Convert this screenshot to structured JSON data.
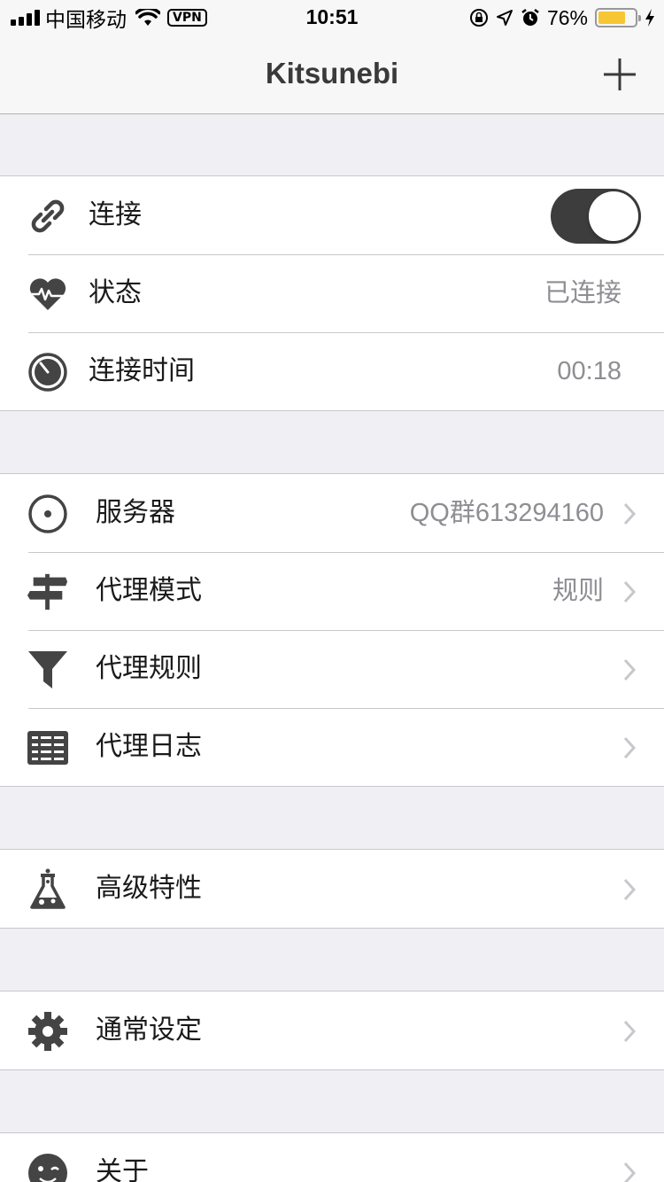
{
  "status_bar": {
    "carrier": "中国移动",
    "vpn": "VPN",
    "time": "10:51",
    "battery_percent": "76%",
    "battery_level": 0.76,
    "battery_color": "#f7c634"
  },
  "nav": {
    "title": "Kitsunebi",
    "add_icon": "plus-icon"
  },
  "connection_section": {
    "connect": {
      "label": "连接",
      "icon": "link-icon",
      "toggle_on": true
    },
    "status": {
      "label": "状态",
      "icon": "heart-pulse-icon",
      "value": "已连接"
    },
    "connect_time": {
      "label": "连接时间",
      "icon": "stopwatch-icon",
      "value": "00:18"
    }
  },
  "proxy_section": {
    "server": {
      "label": "服务器",
      "icon": "target-icon",
      "value": "QQ群613294160"
    },
    "proxy_mode": {
      "label": "代理模式",
      "icon": "signpost-icon",
      "value": "规则"
    },
    "proxy_rules": {
      "label": "代理规则",
      "icon": "funnel-icon"
    },
    "proxy_log": {
      "label": "代理日志",
      "icon": "log-list-icon"
    }
  },
  "advanced_section": {
    "advanced": {
      "label": "高级特性",
      "icon": "flask-icon"
    }
  },
  "general_section": {
    "settings": {
      "label": "通常设定",
      "icon": "gear-icon"
    }
  },
  "about_section": {
    "about": {
      "label": "关于",
      "icon": "wink-face-icon"
    }
  },
  "colors": {
    "toggle_on": "#3d3d3d",
    "background": "#efeff4",
    "secondary_text": "#8e8e93"
  }
}
